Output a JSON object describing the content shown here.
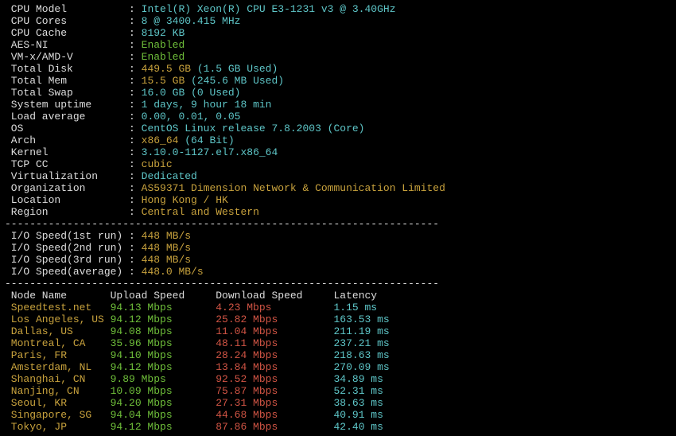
{
  "dashes": "----------------------------------------------------------------------",
  "labels": {
    "cpu_model": " CPU Model          ",
    "cpu_cores": " CPU Cores          ",
    "cpu_cache": " CPU Cache          ",
    "aesni": " AES-NI             ",
    "vmx": " VM-x/AMD-V         ",
    "disk": " Total Disk         ",
    "mem": " Total Mem          ",
    "swap": " Total Swap         ",
    "uptime": " System uptime      ",
    "load": " Load average       ",
    "os": " OS                 ",
    "arch": " Arch               ",
    "kernel": " Kernel             ",
    "tcpcc": " TCP CC             ",
    "virt": " Virtualization     ",
    "org": " Organization       ",
    "loc": " Location           ",
    "region": " Region             ",
    "io1": " I/O Speed(1st run) ",
    "io2": " I/O Speed(2nd run) ",
    "io3": " I/O Speed(3rd run) ",
    "ioa": " I/O Speed(average) "
  },
  "sep": ": ",
  "values": {
    "cpu_model": "Intel(R) Xeon(R) CPU E3-1231 v3 @ 3.40GHz",
    "cpu_cores": "8 @ 3400.415 MHz",
    "cpu_cache": "8192 KB",
    "aesni": "Enabled",
    "vmx": "Enabled",
    "disk_v": "449.5 GB ",
    "disk_u": "(1.5 GB Used)",
    "mem_v": "15.5 GB ",
    "mem_u": "(245.6 MB Used)",
    "swap_v": "16.0 GB ",
    "swap_u": "(0 Used)",
    "uptime": "1 days, 9 hour 18 min",
    "load": "0.00, 0.01, 0.05",
    "os": "CentOS Linux release 7.8.2003 (Core)",
    "arch_v": "x86_64 ",
    "arch_b": "(64 Bit)",
    "kernel": "3.10.0-1127.el7.x86_64",
    "tcpcc": "cubic",
    "virt": "Dedicated",
    "org": "AS59371 Dimension Network & Communication Limited",
    "loc": "Hong Kong / HK",
    "region": "Central and Western",
    "io1": "448 MB/s",
    "io2": "448 MB/s",
    "io3": "448 MB/s",
    "ioa": "448.0 MB/s"
  },
  "speedtest": {
    "headers": {
      "node": " Node Name       ",
      "up": "Upload Speed     ",
      "dn": "Download Speed     ",
      "lat": "Latency    "
    },
    "rows": [
      {
        "node": " Speedtest.net   ",
        "up": "94.13 Mbps       ",
        "dn": "4.23 Mbps          ",
        "lat": "1.15 ms    "
      },
      {
        "node": " Los Angeles, US ",
        "up": "94.12 Mbps       ",
        "dn": "25.82 Mbps         ",
        "lat": "163.53 ms  "
      },
      {
        "node": " Dallas, US      ",
        "up": "94.08 Mbps       ",
        "dn": "11.04 Mbps         ",
        "lat": "211.19 ms  "
      },
      {
        "node": " Montreal, CA    ",
        "up": "35.96 Mbps       ",
        "dn": "48.11 Mbps         ",
        "lat": "237.21 ms  "
      },
      {
        "node": " Paris, FR       ",
        "up": "94.10 Mbps       ",
        "dn": "28.24 Mbps         ",
        "lat": "218.63 ms  "
      },
      {
        "node": " Amsterdam, NL   ",
        "up": "94.12 Mbps       ",
        "dn": "13.84 Mbps         ",
        "lat": "270.09 ms  "
      },
      {
        "node": " Shanghai, CN    ",
        "up": "9.89 Mbps        ",
        "dn": "92.52 Mbps         ",
        "lat": "34.89 ms   "
      },
      {
        "node": " Nanjing, CN     ",
        "up": "10.09 Mbps       ",
        "dn": "75.87 Mbps         ",
        "lat": "52.31 ms   "
      },
      {
        "node": " Seoul, KR       ",
        "up": "94.20 Mbps       ",
        "dn": "27.31 Mbps         ",
        "lat": "38.63 ms   "
      },
      {
        "node": " Singapore, SG   ",
        "up": "94.04 Mbps       ",
        "dn": "44.68 Mbps         ",
        "lat": "40.91 ms   "
      },
      {
        "node": " Tokyo, JP       ",
        "up": "94.12 Mbps       ",
        "dn": "87.86 Mbps         ",
        "lat": "42.40 ms   "
      }
    ]
  }
}
